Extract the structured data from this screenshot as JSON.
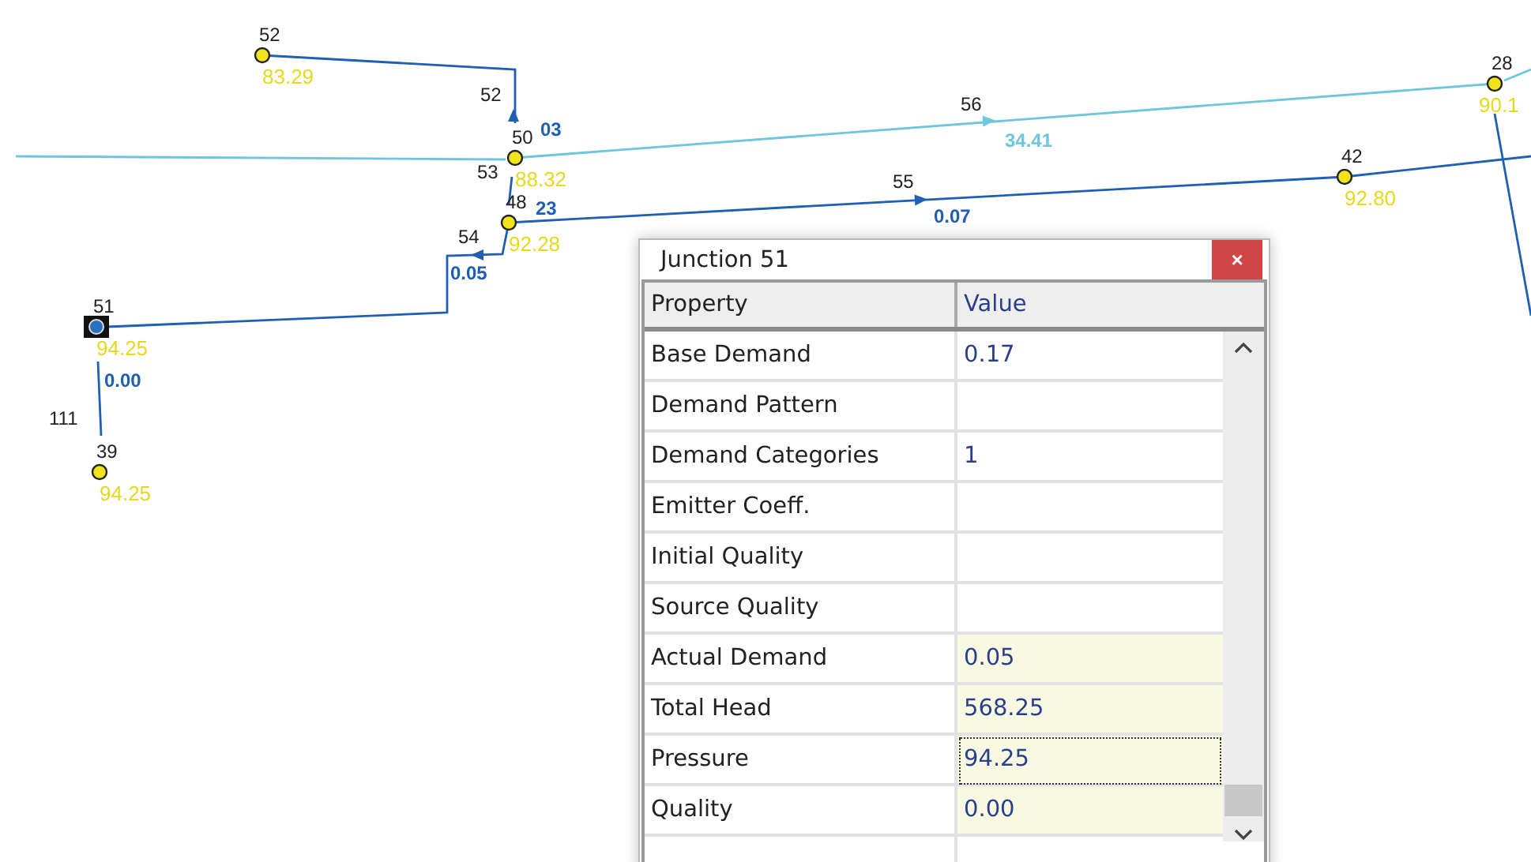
{
  "map": {
    "nodes": [
      {
        "id": "52",
        "value": "83.29",
        "selected": false
      },
      {
        "id": "50",
        "value": "88.32",
        "selected": false
      },
      {
        "id": "48",
        "value": "92.28",
        "selected": false
      },
      {
        "id": "51",
        "value": "94.25",
        "selected": true
      },
      {
        "id": "39",
        "value": "94.25",
        "selected": false
      },
      {
        "id": "28",
        "value": "90.1",
        "selected": false
      },
      {
        "id": "42",
        "value": "92.80",
        "selected": false
      }
    ],
    "links": [
      {
        "id": "52",
        "flow": "03",
        "color": "#1f5fb4"
      },
      {
        "id": "56",
        "flow": "34.41",
        "color": "#6ec6dc"
      },
      {
        "id": "53",
        "flow": "23",
        "color": "#1f5fb4"
      },
      {
        "id": "55",
        "flow": "0.07",
        "color": "#1f5fb4"
      },
      {
        "id": "54",
        "flow": "0.05",
        "color": "#1f5fb4"
      },
      {
        "id": "111",
        "flow": "0.00",
        "color": "#1f5fb4"
      },
      {
        "color": "#6ec6dc"
      },
      {
        "color": "#6ec6dc"
      },
      {
        "color": "#1f5fb4"
      }
    ]
  },
  "panel": {
    "title": "Junction 51",
    "close": "×",
    "columns": [
      "Property",
      "Value"
    ],
    "rows": [
      {
        "property": "Base Demand",
        "value": "0.17",
        "computed": false,
        "selected": false
      },
      {
        "property": "Demand Pattern",
        "value": "",
        "computed": false,
        "selected": false
      },
      {
        "property": "Demand Categories",
        "value": "1",
        "computed": false,
        "selected": false
      },
      {
        "property": "Emitter Coeff.",
        "value": "",
        "computed": false,
        "selected": false
      },
      {
        "property": "Initial Quality",
        "value": "",
        "computed": false,
        "selected": false
      },
      {
        "property": "Source Quality",
        "value": "",
        "computed": false,
        "selected": false
      },
      {
        "property": "Actual Demand",
        "value": "0.05",
        "computed": true,
        "selected": false
      },
      {
        "property": "Total Head",
        "value": "568.25",
        "computed": true,
        "selected": false
      },
      {
        "property": "Pressure",
        "value": "94.25",
        "computed": true,
        "selected": true
      },
      {
        "property": "Quality",
        "value": "0.00",
        "computed": true,
        "selected": false
      }
    ]
  }
}
